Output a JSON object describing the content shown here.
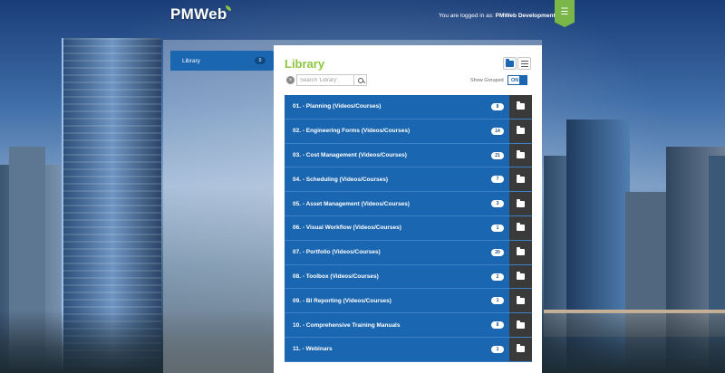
{
  "header": {
    "logo_text": "PMWeb",
    "login_prefix": "You are logged in as:",
    "login_user": "PMWeb Development",
    "user_menu_icon": "menu-icon"
  },
  "sidebar": {
    "items": [
      {
        "label": "Library",
        "count": "0"
      }
    ]
  },
  "library": {
    "title": "Library",
    "search": {
      "placeholder": "Search 'Library'",
      "value": ""
    },
    "show_grouped_label": "Show Grouped",
    "toggle_label": "ON",
    "folders": [
      {
        "label": "01. - Planning (Videos/Courses)",
        "count": "8"
      },
      {
        "label": "02. - Engineering Forms (Videos/Courses)",
        "count": "14"
      },
      {
        "label": "03. - Cost Management (Videos/Courses)",
        "count": "21"
      },
      {
        "label": "04. - Scheduling (Videos/Courses)",
        "count": "7"
      },
      {
        "label": "05. - Asset Management (Videos/Courses)",
        "count": "3"
      },
      {
        "label": "06. - Visual Workflow (Videos/Courses)",
        "count": "1"
      },
      {
        "label": "07. - Portfolio (Videos/Courses)",
        "count": "20"
      },
      {
        "label": "08. - Toolbox (Videos/Courses)",
        "count": "2"
      },
      {
        "label": "09. - BI Reporting (Videos/Courses)",
        "count": "1"
      },
      {
        "label": "10. - Comprehensive Training Manuals",
        "count": "8"
      },
      {
        "label": "11. - Webinars",
        "count": "1"
      }
    ]
  },
  "colors": {
    "primary_blue": "#1a66b0",
    "accent_green": "#8cc63f",
    "dark_action": "#3a3a3a"
  }
}
